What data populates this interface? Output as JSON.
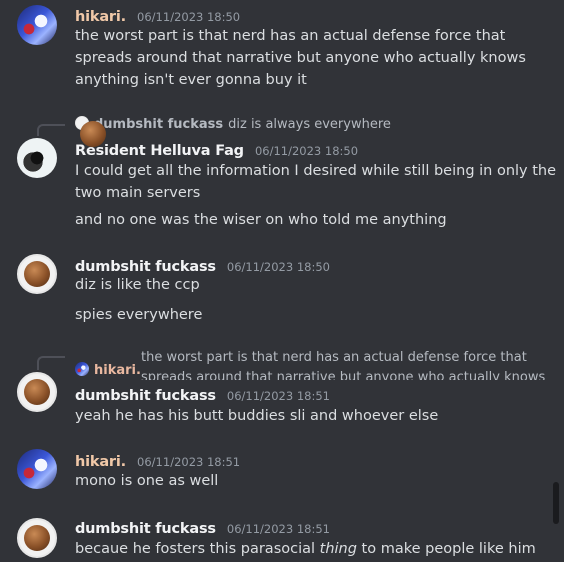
{
  "messages": [
    {
      "author": "hikari.",
      "timestamp": "06/11/2023 18:50",
      "lines": [
        "the worst part is that nerd has an actual defense force that",
        "spreads around that narrative but anyone who actually knows",
        "anything isn't ever gonna buy it"
      ]
    },
    {
      "reply": {
        "author": "dumbshit fuckass",
        "text": "diz is always everywhere"
      },
      "author": "Resident Helluva Fag",
      "timestamp": "06/11/2023 18:50",
      "lines": [
        "I could get all the information I desired while still being in only the",
        "two main servers"
      ],
      "followup": "and no one was the wiser on who told me anything"
    },
    {
      "author": "dumbshit fuckass",
      "timestamp": "06/11/2023 18:50",
      "lines": [
        "diz is like the ccp"
      ],
      "followup": "spies everywhere"
    },
    {
      "reply": {
        "author": "hikari.",
        "text_line1": "the worst part is that nerd has an actual defense force that",
        "text_line2": "spreads around that narrative but anyone who actually knows"
      },
      "author": "dumbshit fuckass",
      "timestamp": "06/11/2023 18:51",
      "lines": [
        "yeah he has his butt buddies sli and whoever else"
      ]
    },
    {
      "author": "hikari.",
      "timestamp": "06/11/2023 18:51",
      "lines": [
        "mono is one as well"
      ]
    },
    {
      "author": "dumbshit fuckass",
      "timestamp": "06/11/2023 18:51",
      "line_before": "becaue he fosters this parasocial ",
      "line_italic": "thing",
      "line_after": " to make people like him"
    }
  ]
}
